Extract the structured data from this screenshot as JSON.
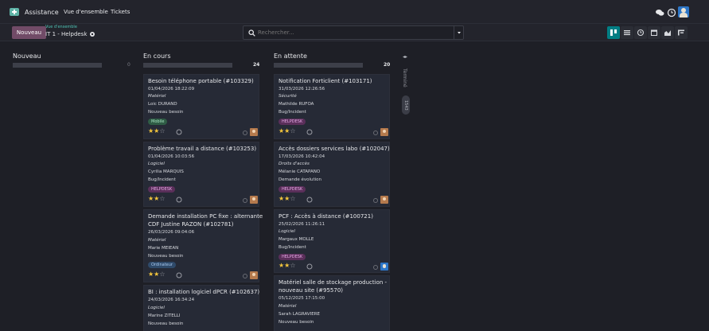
{
  "navbar": {
    "app_name": "Assistance",
    "menu": [
      "Vue d'ensemble",
      "Tickets"
    ],
    "icons": [
      "chat-icon",
      "clock-icon",
      "user-avatar"
    ]
  },
  "control": {
    "new_button": "Nouveau",
    "breadcrumb_parent": "Vue d'ensemble",
    "breadcrumb_current": "IT 1 - Helpdesk",
    "search_placeholder": "Rechercher...",
    "views": [
      "kanban",
      "list",
      "activity",
      "calendar",
      "graph",
      "pivot"
    ]
  },
  "columns": [
    {
      "title": "Nouveau",
      "count": "0"
    },
    {
      "title": "En cours",
      "count": "24"
    },
    {
      "title": "En attente",
      "count": "20"
    }
  ],
  "folded_column": {
    "label": "Terminé",
    "badge": "1543"
  },
  "cards": {
    "c1": {
      "title": "Besoin téléphone portable (#103329)",
      "date": "01/04/2026 18:22:09",
      "category": "Matériel",
      "assignee": "Loic DURAND",
      "type": "Nouveau besoin",
      "tag": "Mobile",
      "rating": 2
    },
    "c2": {
      "title": "Problème travail a distance (#103253)",
      "date": "01/04/2026 10:03:56",
      "category": "Logiciel",
      "assignee": "Cyrilia MARQUIS",
      "type": "Bug/Incident",
      "tag": "HELPDESK",
      "rating": 2
    },
    "c3": {
      "title": "Demande installation PC fixe : alternante",
      "title2": "CDF Justine RAZON (#102781)",
      "date": "26/03/2026 09:04:06",
      "category": "Matériel",
      "assignee": "Marie MEIEAN",
      "type": "Nouveau besoin",
      "tag": "Ordinateur",
      "rating": 2
    },
    "c4": {
      "title": "BI : installation logiciel dPCR (#102637)",
      "date": "24/03/2026 16:34:24",
      "category": "Logiciel",
      "assignee": "Marine ZITELLI",
      "type": "Nouveau besoin"
    },
    "d1": {
      "title": "Notification Forticlient (#103171)",
      "date": "31/03/2026 12:26:56",
      "category": "Sécurité",
      "assignee": "Mathilde RUFOA",
      "type": "Bug/Incident",
      "tag": "HELPDESK",
      "rating": 2
    },
    "d2": {
      "title": "Accès dossiers services labo (#102047)",
      "date": "17/03/2026 10:42:04",
      "category": "Droits d'accès",
      "assignee": "Mélanie CATAPANO",
      "type": "Demande évolution",
      "tag": "HELPDESK",
      "rating": 2
    },
    "d3": {
      "title": "PCF : Accès à distance (#100721)",
      "date": "25/02/2026 11:26:11",
      "category": "Logiciel",
      "assignee": "Margaux MOLLE",
      "type": "Bug/Incident",
      "tag": "HELPDESK",
      "rating": 2
    },
    "d4": {
      "title": "Matériel salle de stockage production -",
      "title2": "nouveau site (#95570)",
      "date": "05/12/2025 17:15:00",
      "category": "Matériel",
      "assignee": "Sarah LAGRAVIERE",
      "type": "Nouveau besoin"
    }
  },
  "colors": {
    "accent": "#017e84",
    "primary": "#714b67",
    "star": "#f3c53c",
    "background": "#1e1f26"
  }
}
